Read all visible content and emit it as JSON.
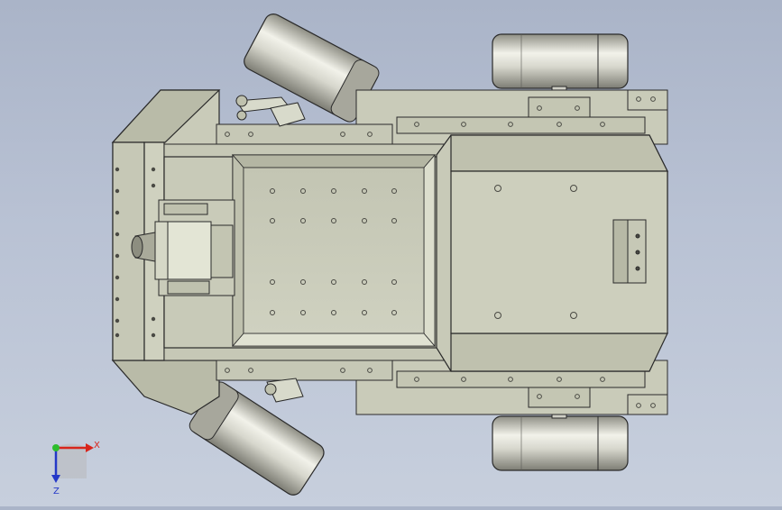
{
  "viewport": {
    "background_top": "#aab4c8",
    "background_bottom": "#c7cfdd"
  },
  "model": {
    "body_color": "#c9cbb9",
    "body_shade": "#b4b6a3",
    "edge_color": "#2a2a2a",
    "wheel_color": "#d0d0c4",
    "hole_color": "#4a4a44"
  },
  "triad": {
    "x_label": "X",
    "y_label": "Y",
    "z_label": "Z",
    "x_color": "#d8251c",
    "y_color": "#2dbd2d",
    "z_color": "#2438c8"
  }
}
